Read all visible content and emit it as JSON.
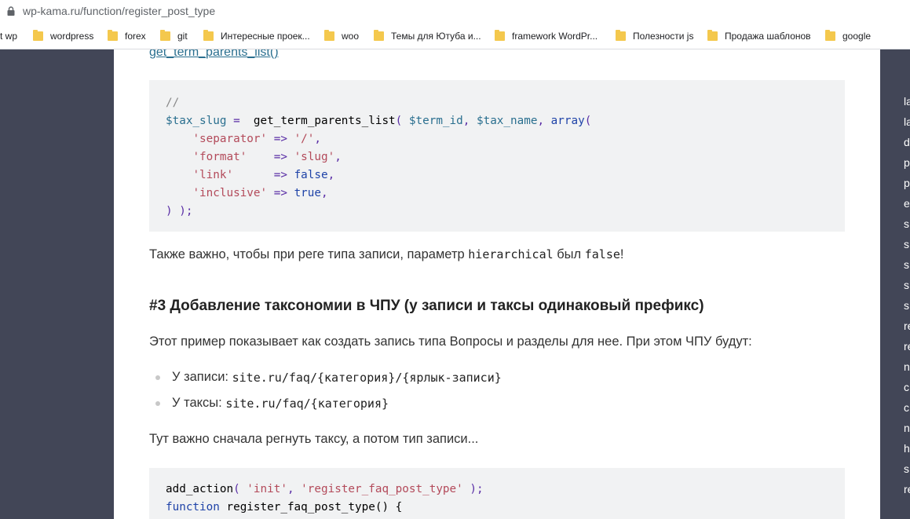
{
  "browser": {
    "url": "wp-kama.ru/function/register_post_type",
    "bookmarks": [
      {
        "label": "t wp",
        "folder": false
      },
      {
        "label": "wordpress",
        "folder": true
      },
      {
        "label": "forex",
        "folder": true
      },
      {
        "label": "git",
        "folder": true
      },
      {
        "label": "Интересные проек...",
        "folder": true
      },
      {
        "label": "woo",
        "folder": true
      },
      {
        "label": "Темы для Ютуба и...",
        "folder": true
      },
      {
        "label": "framework WordPr...",
        "folder": true
      },
      {
        "label": "Полезности js",
        "folder": true
      },
      {
        "label": "Продажа шаблонов",
        "folder": true
      },
      {
        "label": "google",
        "folder": true
      }
    ]
  },
  "article": {
    "function_link": "get_term_parents_list()",
    "code1": {
      "comment": "//",
      "var_tax_slug": "$tax_slug",
      "assign": " =  ",
      "fn_call": "get_term_parents_list",
      "open_paren": "( ",
      "var_term_id": "$term_id",
      "comma1": ", ",
      "var_tax_name": "$tax_name",
      "comma2": ", ",
      "kw_array": "array",
      "paren_open2": "(",
      "rows": [
        {
          "indent": "    ",
          "key": "'separator'",
          "pad": " ",
          "arrow": "=>",
          "sp": " ",
          "val": "'/'",
          "val_type": "str",
          "tail": ","
        },
        {
          "indent": "    ",
          "key": "'format'",
          "pad": "    ",
          "arrow": "=>",
          "sp": " ",
          "val": "'slug'",
          "val_type": "str",
          "tail": ","
        },
        {
          "indent": "    ",
          "key": "'link'",
          "pad": "      ",
          "arrow": "=>",
          "sp": " ",
          "val": "false",
          "val_type": "kw",
          "tail": ","
        },
        {
          "indent": "    ",
          "key": "'inclusive'",
          "pad": " ",
          "arrow": "=>",
          "sp": " ",
          "val": "true",
          "val_type": "kw",
          "tail": ","
        }
      ],
      "close": ") );"
    },
    "para1": {
      "text1": "Также важно, чтобы при реге типа записи, параметр ",
      "code1": "hierarchical",
      "text2": " был ",
      "code2": "false",
      "text3": "!"
    },
    "heading": "#3 Добавление таксономии в ЧПУ (у записи и таксы одинаковый префикс)",
    "para2": "Этот пример показывает как создать запись типа Вопросы и разделы для нее. При этом ЧПУ будут:",
    "list": [
      {
        "label": "У записи: ",
        "code": "site.ru/faq/{категория}/{ярлык-записи}"
      },
      {
        "label": "У таксы: ",
        "code": "site.ru/faq/{категория}"
      }
    ],
    "para3": "Тут важно сначала регнуть таксу, а потом тип записи...",
    "code2": {
      "l1_fn": "add_action",
      "l1_open": "( ",
      "l1_s1": "'init'",
      "l1_comma": ", ",
      "l1_s2": "'register_faq_post_type'",
      "l1_close": " );",
      "l2_kw": "function",
      "l2_rest": " register_faq_post_type() {"
    }
  },
  "sidebar": {
    "items": [
      "la",
      "la",
      "d",
      "p",
      "p",
      "e",
      "s",
      "s",
      "s",
      "s",
      "s",
      "re",
      "re",
      "n",
      "c",
      "c",
      "n",
      "h",
      "s",
      "re"
    ]
  },
  "colors": {
    "page_bg": "#424657",
    "code_bg": "#f1f2f3",
    "link": "#2a6f8f",
    "string": "#b34a5a",
    "keyword": "#1f43a8"
  }
}
